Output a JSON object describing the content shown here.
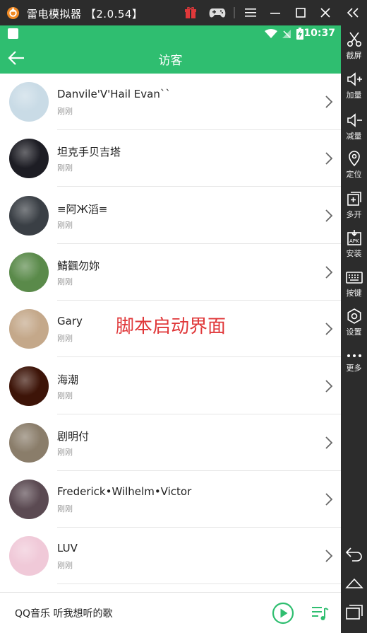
{
  "window": {
    "title": "雷电模拟器 【2.0.54】",
    "icons": [
      "gift-icon",
      "gamepad-icon",
      "menu-icon",
      "minimize-icon",
      "maximize-icon",
      "close-icon",
      "collapse-sidebar-icon"
    ]
  },
  "statusbar": {
    "time": "10:37"
  },
  "appbar": {
    "title": "访客"
  },
  "visitors": [
    {
      "name": "Danvile'V'Hail Evan``",
      "time": "刚刚",
      "avatar_color": "#c9dbe6"
    },
    {
      "name": "坦克手贝吉塔",
      "time": "刚刚",
      "avatar_color": "#1d1d24"
    },
    {
      "name": "≡阿Ж滔≡",
      "time": "刚刚",
      "avatar_color": "#3a3f45"
    },
    {
      "name": "鯖飌勿妳",
      "time": "刚刚",
      "avatar_color": "#5a8a4a"
    },
    {
      "name": "Gary",
      "time": "刚刚",
      "avatar_color": "#c4a88a"
    },
    {
      "name": "海潮",
      "time": "刚刚",
      "avatar_color": "#3d1408"
    },
    {
      "name": "剧明付",
      "time": "刚刚",
      "avatar_color": "#8a7d6a"
    },
    {
      "name": "Frederick•Wilhelm•Victor",
      "time": "刚刚",
      "avatar_color": "#5b4a52"
    },
    {
      "name": "LUV",
      "time": "刚刚",
      "avatar_color": "#f0c9d8"
    }
  ],
  "overlay_text": "脚本启动界面",
  "player": {
    "text": "QQ音乐 听我想听的歌"
  },
  "sidebar": {
    "items": [
      {
        "label": "截屏",
        "icon": "scissors-icon"
      },
      {
        "label": "加量",
        "icon": "volume-up-icon"
      },
      {
        "label": "减量",
        "icon": "volume-down-icon"
      },
      {
        "label": "定位",
        "icon": "location-icon"
      },
      {
        "label": "多开",
        "icon": "multi-instance-icon"
      },
      {
        "label": "安装",
        "icon": "apk-install-icon"
      },
      {
        "label": "按键",
        "icon": "keyboard-icon"
      },
      {
        "label": "设置",
        "icon": "gear-icon"
      },
      {
        "label": "更多",
        "icon": "more-icon"
      }
    ],
    "nav": [
      "back-icon",
      "home-icon",
      "recents-icon"
    ]
  },
  "colors": {
    "accent": "#2fbe70",
    "overlay": "#e0383a",
    "chrome": "#2c2c2c"
  }
}
